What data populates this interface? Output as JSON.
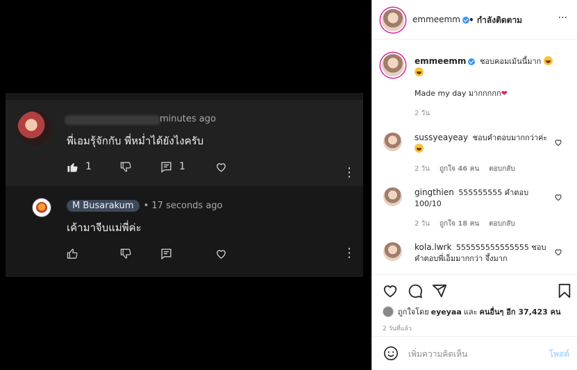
{
  "youtube": {
    "comment1": {
      "time_suffix": "minutes ago",
      "text": "พี่เอมรุ้จักกับ พี่หม่ำได้ยังไงครับ",
      "likes": "1",
      "replies": "1"
    },
    "comment2": {
      "author": "M Busarakum",
      "time": "• 17 seconds ago",
      "text": "เค้ามาจีบแม่พี่ค่ะ"
    },
    "icons": [
      "like-icon",
      "dislike-icon",
      "reply-icon",
      "heart-icon",
      "more-vertical-icon"
    ]
  },
  "instagram": {
    "header": {
      "username": "emmeemm",
      "follow_status": "• กำลังติดตาม",
      "more": "···"
    },
    "caption": {
      "username": "emmeemm",
      "text_1": "ชอบคอมเม้นนี้มาก",
      "text_2": "Made my day มากกกกก",
      "time": "2 วัน"
    },
    "comments": [
      {
        "username": "sussyeayeay",
        "text": "ชอบคำตอบมากกว่าค่ะ",
        "time": "2 วัน",
        "likes": "ถูกใจ 46 คน",
        "reply": "ตอบกลับ"
      },
      {
        "username": "gingthien",
        "text": "555555555 คำตอบ 100/10",
        "time": "2 วัน",
        "likes": "ถูกใจ 18 คน",
        "reply": "ตอบกลับ"
      },
      {
        "username": "kola.lwrk",
        "text": "555555555555555 ชอบคำตอบพี่เอ็มมากกว่า จึ้งมาก"
      }
    ],
    "liked_by": {
      "prefix": "ถูกใจโดย",
      "user": "eyeyaa",
      "middle": "และ",
      "others": "คนอื่นๆ อีก 37,423 คน"
    },
    "post_time": "2 วันที่แล้ว",
    "add_comment": {
      "placeholder": "เพิ่มความคิดเห็น",
      "post_label": "โพสต์"
    },
    "colors": {
      "accent": "#3897f0",
      "muted": "#8e8e8e",
      "heart": "#e0245e"
    }
  }
}
